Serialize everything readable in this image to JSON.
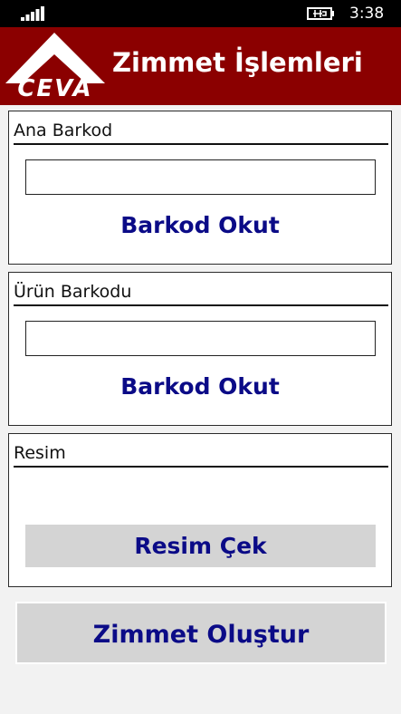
{
  "status_bar": {
    "time": "3:38",
    "signal_icon": "signal-bars-icon",
    "battery_icon": "battery-charging-icon"
  },
  "header": {
    "logo_text": "CEVA",
    "title": "Zimmet İşlemleri",
    "background_color": "#8b0000"
  },
  "sections": {
    "main_barcode": {
      "label": "Ana Barkod",
      "input_value": "",
      "scan_button": "Barkod Okut"
    },
    "product_barcode": {
      "label": "Ürün Barkodu",
      "input_value": "",
      "scan_button": "Barkod Okut"
    },
    "image": {
      "label": "Resim",
      "photo_button": "Resim Çek"
    }
  },
  "actions": {
    "submit_label": "Zimmet Oluştur"
  },
  "colors": {
    "accent_text": "#0b0b87",
    "button_gray": "#d4d4d4"
  }
}
